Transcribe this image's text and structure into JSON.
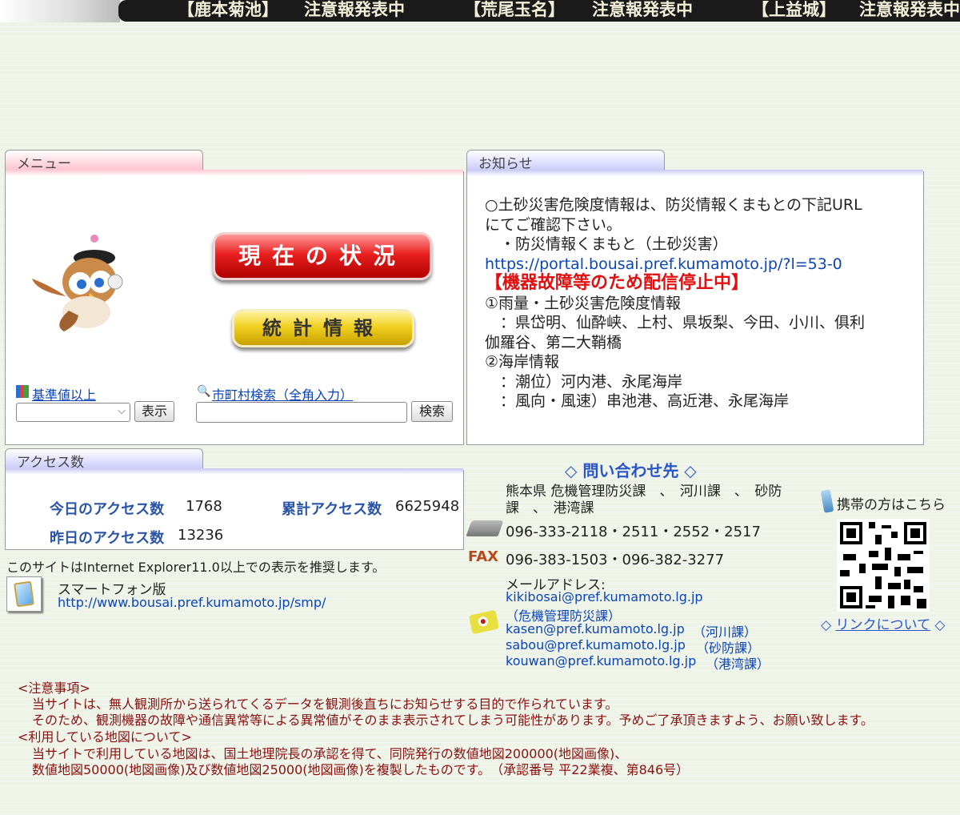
{
  "ticker": [
    {
      "area": "【鹿本菊池】",
      "status": "注意報発表中"
    },
    {
      "area": "【荒尾玉名】",
      "status": "注意報発表中"
    },
    {
      "area": "【上益城】",
      "status": "注意報発表中"
    }
  ],
  "menu": {
    "tab_label": "メニュー",
    "current_status_btn": "現在の状況",
    "stats_btn": "統計情報",
    "threshold_link": "基準値以上",
    "threshold_select_value": "",
    "show_btn": "表示",
    "city_search_link": "市町村検索（全角入力）",
    "city_search_value": "",
    "search_btn": "検索"
  },
  "notice": {
    "tab_label": "お知らせ",
    "lines": [
      "○土砂災害危険度情報は、防災情報くまもとの下記URL",
      "にてご確認下さい。",
      "　・防災情報くまもと（土砂災害）",
      "https://portal.bousai.pref.kumamoto.jp/?l=53-0",
      "",
      "【機器故障等のため配信停止中】",
      "①雨量・土砂災害危険度情報",
      "　：県岱明、仙酔峡、上村、県坂梨、今田、小川、俱利",
      "伽羅谷、第二大鞘橋",
      "②海岸情報",
      "　：潮位）河内港、永尾海岸",
      "　：風向・風速）串池港、高近港、永尾海岸"
    ]
  },
  "access": {
    "tab_label": "アクセス数",
    "today_label": "今日のアクセス数",
    "today_value": "1768",
    "total_label": "累計アクセス数",
    "total_value": "6625948",
    "yesterday_label": "昨日のアクセス数",
    "yesterday_value": "13236"
  },
  "ie_note": "このサイトはInternet Explorer11.0以上での表示を推奨します。",
  "smartphone": {
    "title": "スマートフォン版",
    "url": "http://www.bousai.pref.kumamoto.jp/smp/"
  },
  "contact": {
    "heading": "◇ 問い合わせ先 ◇",
    "dept_line1": "熊本県 危機管理防災課　、　河川課　、　砂防",
    "dept_line2": "課　、　港湾課",
    "tel": "096-333-2118・2511・2552・2517",
    "fax_label": "FAX",
    "fax": "096-383-1503・096-382-3277",
    "mail_label": "メールアドレス:",
    "mails": [
      {
        "addr": "kikibosai@pref.kumamoto.lg.jp",
        "note": ""
      },
      {
        "addr": "",
        "note": "（危機管理防災課）"
      },
      {
        "addr": "kasen@pref.kumamoto.lg.jp",
        "note": "（河川課）"
      },
      {
        "addr": "sabou@pref.kumamoto.lg.jp",
        "note": "（砂防課）"
      },
      {
        "addr": "kouwan@pref.kumamoto.lg.jp",
        "note": "（港湾課）"
      }
    ]
  },
  "mobile": {
    "label": "携帯の方はこちら",
    "link_prefix": "◇",
    "link_text": "リンクについて",
    "link_suffix": "◇"
  },
  "caution": {
    "h1": "<注意事項>",
    "p1a": "当サイトは、無人観測所から送られてくるデータを観測後直ちにお知らせする目的で作られています。",
    "p1b": "そのため、観測機器の故障や通信異常等による異常値がそのまま表示されてしまう可能性があります。予めご了承頂きますよう、お願い致します。",
    "h2": "<利用している地図について>",
    "p2a": "当サイトで利用している地図は、国土地理院長の承認を得て、同院発行の数値地図200000(地図画像)、",
    "p2b": "数値地図50000(地図画像)及び数値地図25000(地図画像)を複製したものです。　（承認番号 平22業複、第846号）"
  }
}
